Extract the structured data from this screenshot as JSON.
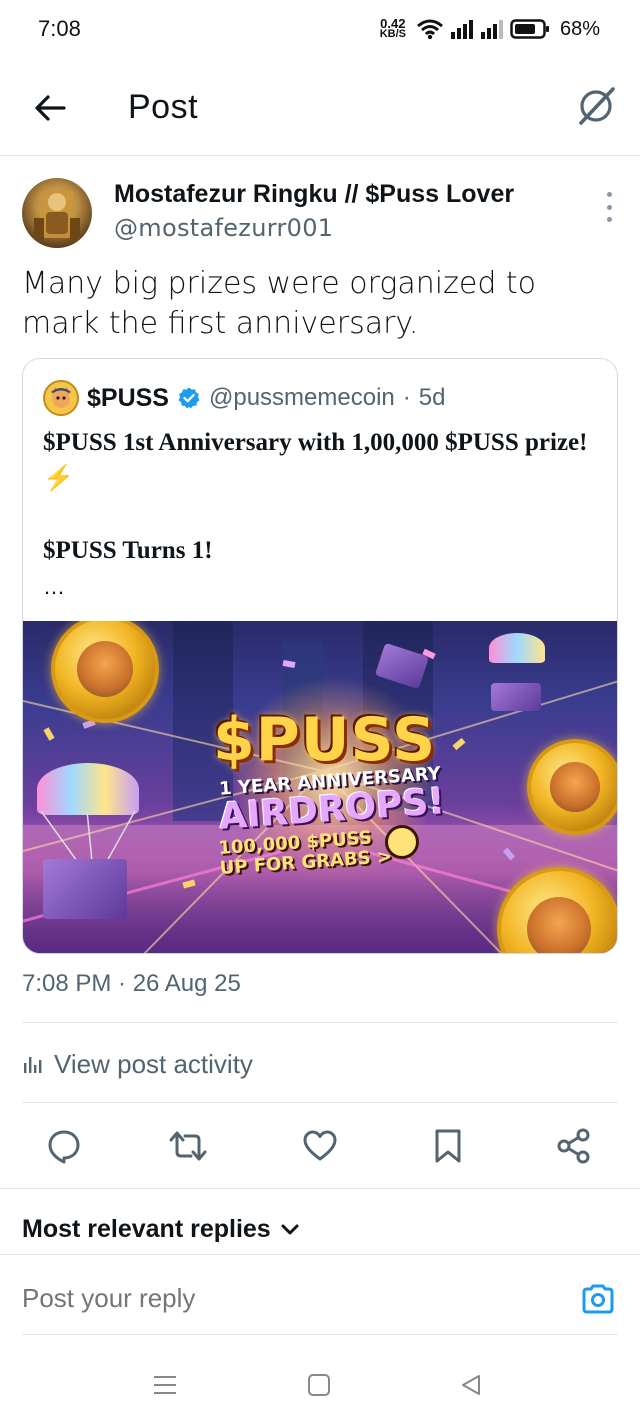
{
  "status_bar": {
    "time": "7:08",
    "net_speed_value": "0.42",
    "net_speed_unit": "KB/S",
    "battery": "68%"
  },
  "header": {
    "title": "Post",
    "back_icon": "arrow-left-icon",
    "grok_icon": "grok-icon"
  },
  "post": {
    "author_name": "Mostafezur Ringku // $Puss Lover",
    "author_handle": "@mostafezurr001",
    "text": "Many big prizes were organized to mark the first anniversary.",
    "timestamp": "7:08 PM · 26 Aug 25"
  },
  "quote": {
    "name": "$PUSS",
    "handle": "@pussmemecoin",
    "age": "5d",
    "line1": "$PUSS 1st Anniversary with 1,00,000 $PUSS prize! ⚡",
    "line2": "$PUSS Turns 1!",
    "ellipsis": "…",
    "image": {
      "title": "$PUSS",
      "sub1": "1 YEAR ANNIVERSARY",
      "sub2": "AIRDROPS!",
      "sub3a": "100,000 $PUSS",
      "sub3b": "UP FOR GRABS >"
    }
  },
  "activity": {
    "label": "View post activity"
  },
  "actions": [
    "reply-icon",
    "repost-icon",
    "like-icon",
    "bookmark-icon",
    "share-icon"
  ],
  "replies": {
    "sort_label": "Most relevant replies"
  },
  "reply_bar": {
    "placeholder": "Post your reply"
  },
  "colors": {
    "accent": "#1d9bf0",
    "muted_text": "#536471",
    "divider": "#e6e6e6"
  }
}
